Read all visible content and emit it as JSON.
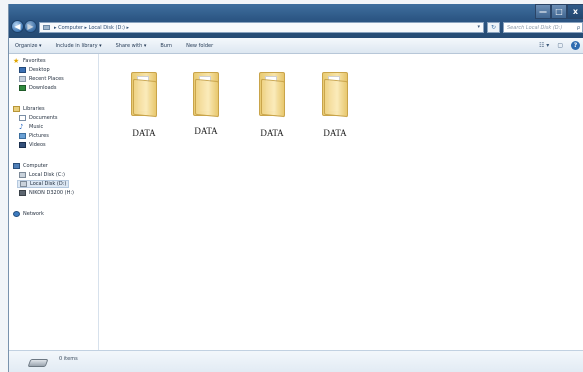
{
  "window": {
    "controls": {
      "minimize": "—",
      "maximize": "□",
      "close": "x"
    }
  },
  "address": {
    "icon": "computer-icon",
    "path": "▸ Computer ▸ Local Disk (D:) ▸",
    "dropdown": "▾"
  },
  "nav_buttons": {
    "back": "◀",
    "forward": "▶"
  },
  "refresh_label": "↻",
  "search": {
    "placeholder": "Search Local Disk (D:)",
    "icon": "search-icon",
    "glyph": "ρ"
  },
  "toolbar": {
    "items": [
      "Organize ▾",
      "Include in library ▾",
      "Share with ▾",
      "Burn",
      "New folder"
    ],
    "right": {
      "views": "☷ ▾",
      "preview": "▢",
      "help": "?"
    }
  },
  "navpane": {
    "favorites": {
      "label": "Favorites",
      "items": [
        "Desktop",
        "Recent Places",
        "Downloads"
      ]
    },
    "libraries": {
      "label": "Libraries",
      "items": [
        "Documents",
        "Music",
        "Pictures",
        "Videos"
      ]
    },
    "computer": {
      "label": "Computer",
      "items": [
        "Local Disk (C:)",
        "Local Disk (D:)",
        "NIKON D3200 (H:)"
      ]
    },
    "network": {
      "label": "Network"
    }
  },
  "folders": [
    {
      "name": "DATA"
    },
    {
      "name": "DATA"
    },
    {
      "name": "DATA"
    },
    {
      "name": "DATA"
    }
  ],
  "details": {
    "item_count": "0 items"
  },
  "colors": {
    "titlebar": "#2c5684",
    "selection": "#dde8f4",
    "folder": "#f0d487"
  }
}
